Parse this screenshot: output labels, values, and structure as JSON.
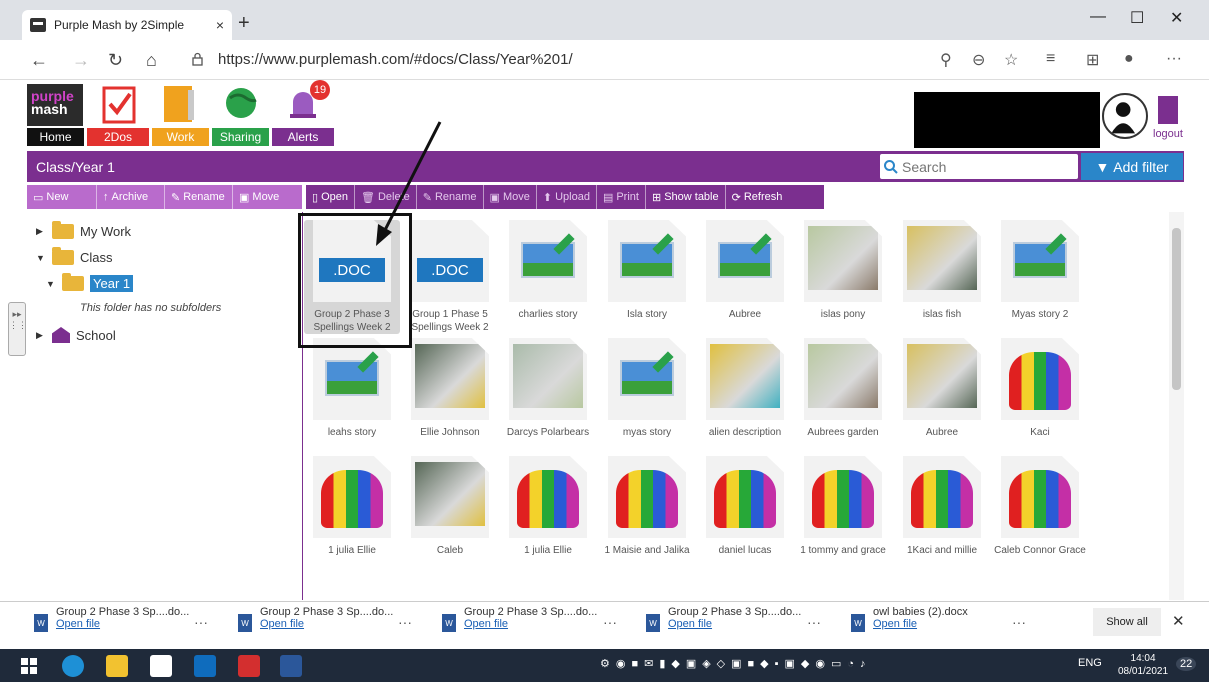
{
  "browser": {
    "tab_title": "Purple Mash by 2Simple",
    "tab_close": "×",
    "new_tab": "+",
    "url": "https://www.purplemash.com/#docs/Class/Year%201/",
    "window_minimize": "—",
    "window_maximize": "☐",
    "window_close": "✕",
    "back": "←",
    "forward": "→",
    "reload": "↻",
    "home": "⌂",
    "more": "···"
  },
  "pm_header": {
    "logo_top": "purple",
    "logo_bottom": "mash",
    "nav": [
      "Home",
      "2Dos",
      "Work",
      "Sharing",
      "Alerts"
    ],
    "alerts_count": "19",
    "logout_label": "logout"
  },
  "location_bar": {
    "path": "Class/Year 1",
    "search_placeholder": "Search",
    "add_filter": "Add filter"
  },
  "toolbar_left": [
    "New",
    "Archive",
    "Rename",
    "Move"
  ],
  "toolbar_right": [
    "Open",
    "Delete",
    "Rename",
    "Move",
    "Upload",
    "Print",
    "Show table",
    "Refresh"
  ],
  "tree": {
    "my_work": "My Work",
    "class": "Class",
    "year1": "Year 1",
    "no_subfolders": "This folder has no subfolders",
    "school": "School"
  },
  "files": [
    {
      "name": "Group 2 Phase 3 Spellings Week 2",
      "type": "doc",
      "label": ".DOC"
    },
    {
      "name": "Group 1 Phase 5 Spellings Week 2",
      "type": "doc",
      "label": ".DOC"
    },
    {
      "name": "charlies story",
      "type": "story"
    },
    {
      "name": "Isla story",
      "type": "story"
    },
    {
      "name": "Aubree",
      "type": "story"
    },
    {
      "name": "islas pony",
      "type": "photo"
    },
    {
      "name": "islas fish",
      "type": "photo"
    },
    {
      "name": "Myas story 2",
      "type": "story"
    },
    {
      "name": "leahs story",
      "type": "story"
    },
    {
      "name": "Ellie Johnson",
      "type": "photo"
    },
    {
      "name": "Darcys Polarbears",
      "type": "photo"
    },
    {
      "name": "myas story",
      "type": "story"
    },
    {
      "name": "alien description",
      "type": "photo"
    },
    {
      "name": "Aubrees garden",
      "type": "photo"
    },
    {
      "name": "Aubree",
      "type": "photo"
    },
    {
      "name": "Kaci",
      "type": "elephant"
    },
    {
      "name": "1 julia Ellie",
      "type": "elephant"
    },
    {
      "name": "Caleb",
      "type": "photo"
    },
    {
      "name": "1 julia Ellie",
      "type": "elephant"
    },
    {
      "name": "1 Maisie and Jalika",
      "type": "elephant"
    },
    {
      "name": "daniel lucas",
      "type": "elephant"
    },
    {
      "name": "1 tommy and grace",
      "type": "elephant"
    },
    {
      "name": "1Kaci and millie",
      "type": "elephant"
    },
    {
      "name": "Caleb Connor Grace",
      "type": "elephant"
    }
  ],
  "downloads": {
    "items": [
      {
        "name": "Group 2 Phase 3 Sp....do...",
        "open": "Open file"
      },
      {
        "name": "Group 2 Phase 3 Sp....do...",
        "open": "Open file"
      },
      {
        "name": "Group 2 Phase 3 Sp....do...",
        "open": "Open file"
      },
      {
        "name": "Group 2 Phase 3 Sp....do...",
        "open": "Open file"
      },
      {
        "name": "owl babies (2).docx",
        "open": "Open file"
      }
    ],
    "more": "···",
    "show_all": "Show all",
    "close": "✕"
  },
  "taskbar": {
    "lang": "ENG",
    "time": "14:04",
    "date": "08/01/2021",
    "notifications": "22"
  },
  "colors": {
    "purple": "#7b2f8f",
    "light_purple": "#b96bcc",
    "blue": "#2a86c9",
    "home_tab": "#111111",
    "twodos_tab": "#e3322f",
    "work_tab": "#f0a21e",
    "sharing_tab": "#2aa14a",
    "alerts_tab": "#7b2f8f"
  }
}
